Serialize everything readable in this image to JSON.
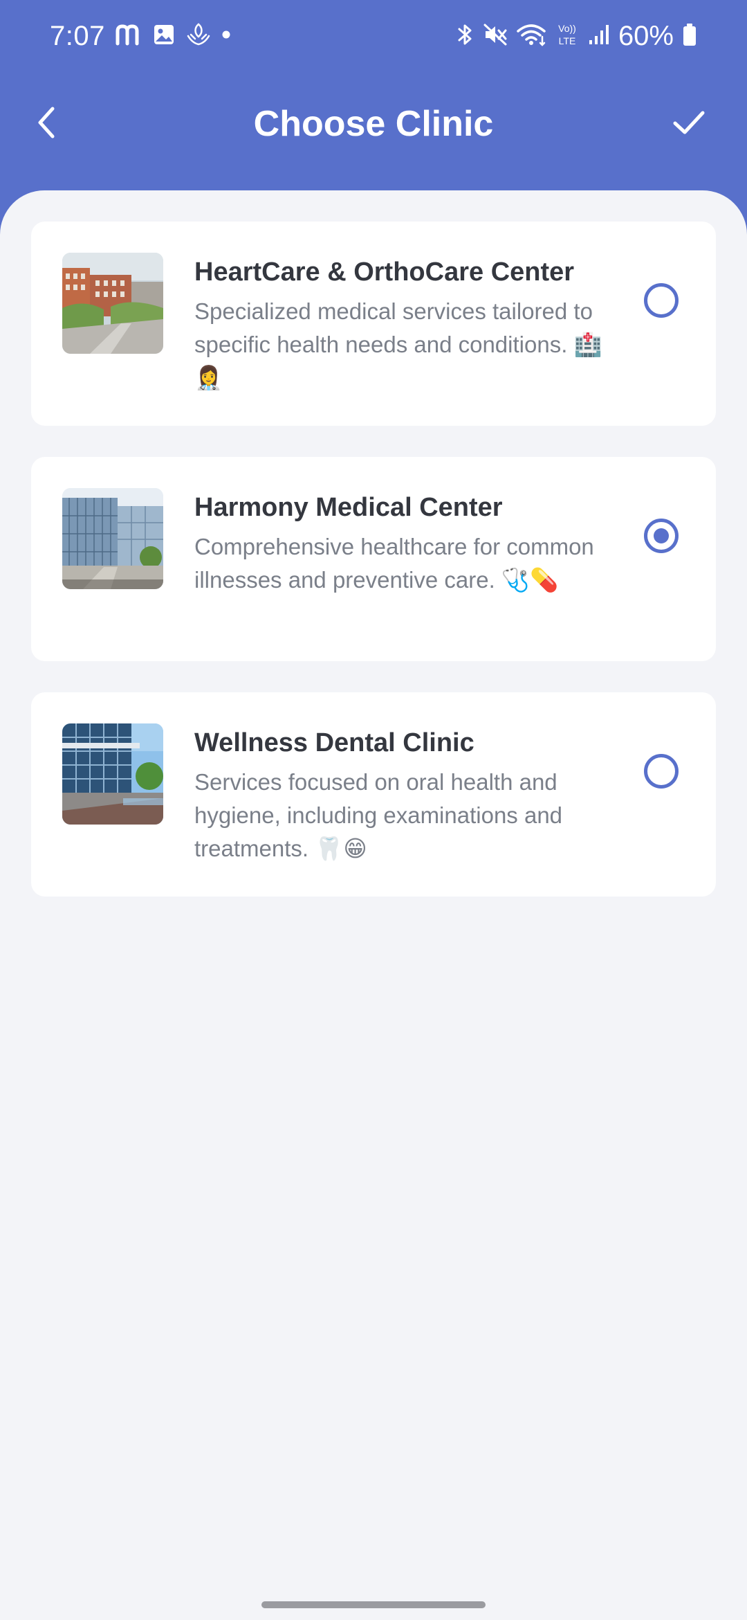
{
  "status_bar": {
    "time": "7:07",
    "battery": "60%",
    "network": "LTE"
  },
  "header": {
    "title": "Choose Clinic",
    "back_icon": "chevron-left-icon",
    "confirm_icon": "checkmark-icon"
  },
  "clinics": [
    {
      "name": "HeartCare & OrthoCare Center",
      "description": "Specialized medical services tailored to specific health needs and conditions. 🏥👩‍⚕️",
      "selected": false
    },
    {
      "name": "Harmony Medical Center",
      "description": "Comprehensive healthcare for common illnesses and preventive care. 🩺💊",
      "selected": true
    },
    {
      "name": "Wellness Dental Clinic",
      "description": "Services focused on oral health and hygiene, including examinations and treatments. 🦷😁",
      "selected": false
    }
  ],
  "colors": {
    "primary": "#5870cb",
    "background": "#f3f4f8",
    "card": "#ffffff",
    "title_text": "#34373f",
    "body_text": "#7a7f89"
  }
}
